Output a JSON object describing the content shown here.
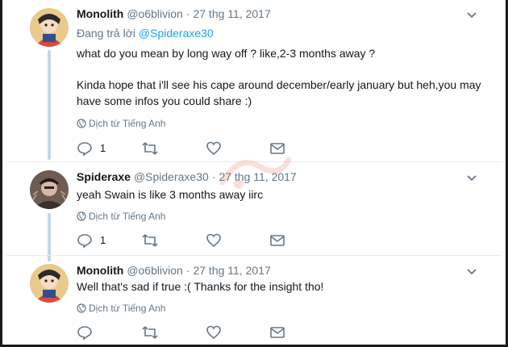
{
  "tweets": [
    {
      "name": "Monolith",
      "handle": "@o6blivion",
      "separator": "·",
      "time": "27 thg 11, 2017",
      "replying_prefix": "Đang trả lời ",
      "replying_to": "@Spideraxe30",
      "lines": [
        "what do you mean by long way off ? like,2-3 months away ?",
        "",
        "Kinda hope that i'll see his cape around december/early january but heh,you may",
        "have some infos you could share :)"
      ],
      "translate_label": "Dịch từ Tiếng Anh",
      "reply_count": "1",
      "avatar_icon": "anime-character-avatar"
    },
    {
      "name": "Spideraxe",
      "handle": "@Spideraxe30",
      "separator": "·",
      "time": "27 thg 11, 2017",
      "lines": [
        "yeah Swain is like 3 months away iirc"
      ],
      "translate_label": "Dịch từ Tiếng Anh",
      "reply_count": "1",
      "avatar_icon": "spider-character-avatar"
    },
    {
      "name": "Monolith",
      "handle": "@o6blivion",
      "separator": "·",
      "time": "27 thg 11, 2017",
      "lines": [
        "Well that's sad if true :( Thanks for the insight tho!"
      ],
      "translate_label": "Dịch từ Tiếng Anh",
      "reply_count": "",
      "avatar_icon": "anime-character-avatar"
    }
  ],
  "icons": {
    "reply": "reply-icon",
    "retweet": "retweet-icon",
    "like": "heart-icon",
    "dm": "envelope-icon",
    "globe": "globe-icon",
    "menu": "chevron-down-icon"
  },
  "colors": {
    "link": "#1da1f2",
    "muted": "#657786",
    "thread": "#c4d6e6"
  }
}
